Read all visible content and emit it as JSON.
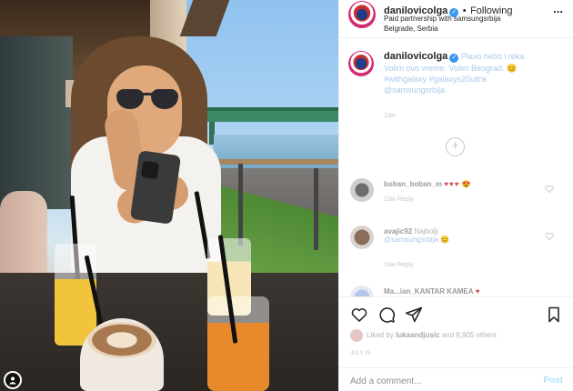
{
  "photo": {
    "alt_icon": "tag-person-icon"
  },
  "header": {
    "username": "danilovicolga",
    "separator": "•",
    "follow_label": "Following",
    "subtitle": "Paid partnership with samsungsrbija",
    "location": "Belgrade, Serbia",
    "more_label": "..."
  },
  "caption": {
    "username": "danilovicolga",
    "text_segments": [
      "Plavo nebo i reka",
      "Volim ovo vreme. Volim Beograd.",
      "#withgalaxy #galaxys20ultra",
      "@samsungsrbija"
    ],
    "emoji": "😊",
    "time": "13w"
  },
  "load_more_label": "+",
  "comments": [
    {
      "username": "boban_boban_m",
      "text": "",
      "emoji": "♥♥♥",
      "emoji2": "😍",
      "meta": "13w   Reply"
    },
    {
      "username": "avajic92",
      "text": "Najbolji",
      "mention": "@samsungsrbija",
      "emoji2": "😊",
      "meta": "13w   Reply"
    },
    {
      "username": "Ma...ian_KANTAR KAMEA",
      "text": "",
      "emoji": "♥",
      "emoji2": "",
      "meta": ""
    }
  ],
  "likes": {
    "text_prefix": "Liked by",
    "liker": "lukaandjusic",
    "text_suffix": "and 8,905 others"
  },
  "date": "JULY 25",
  "add_comment": {
    "placeholder": "Add a comment...",
    "post_label": "Post"
  },
  "colors": {
    "accent_blue": "#3897f0",
    "post_disabled": "#b2dffc",
    "muted": "#8e8e8e"
  }
}
